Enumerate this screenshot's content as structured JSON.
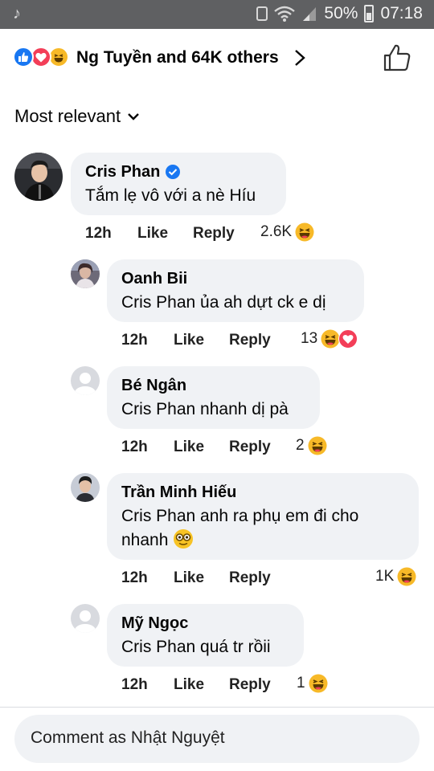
{
  "status_bar": {
    "battery": "50%",
    "time": "07:18"
  },
  "reactions": {
    "summary": "Ng Tuyền and 64K others"
  },
  "sort": {
    "label": "Most relevant"
  },
  "comments": [
    {
      "author": "Cris Phan",
      "verified": true,
      "text": "Tắm lẹ vô với a nè Híu",
      "time": "12h",
      "like": "Like",
      "reply": "Reply",
      "reaction_count": "2.6K",
      "reactions": [
        "haha"
      ]
    },
    {
      "author": "Oanh Bii",
      "text": "Cris Phan ủa ah dựt ck e dị",
      "time": "12h",
      "like": "Like",
      "reply": "Reply",
      "reaction_count": "13",
      "reactions": [
        "haha",
        "love"
      ]
    },
    {
      "author": "Bé Ngân",
      "text": "Cris Phan nhanh dị pà",
      "time": "12h",
      "like": "Like",
      "reply": "Reply",
      "reaction_count": "2",
      "reactions": [
        "haha"
      ]
    },
    {
      "author": "Trần Minh Hiếu",
      "text_line1": "Cris Phan anh ra phụ em đi cho",
      "text_line2": "nhanh",
      "text_emoji": "nerd-face",
      "time": "12h",
      "like": "Like",
      "reply": "Reply",
      "reaction_count": "1K",
      "reactions": [
        "haha"
      ]
    },
    {
      "author": "Mỹ Ngọc",
      "text": "Cris Phan quá tr rồii",
      "time": "12h",
      "like": "Like",
      "reply": "Reply",
      "reaction_count": "1",
      "reactions": [
        "haha"
      ]
    }
  ],
  "composer": {
    "placeholder": "Comment as Nhật Nguyệt"
  },
  "colors": {
    "status_bar": "#5f6062",
    "bubble": "#f0f2f5",
    "like_blue": "#1877f2",
    "love_red": "#f33e58",
    "haha_yellow": "#f7b928"
  }
}
